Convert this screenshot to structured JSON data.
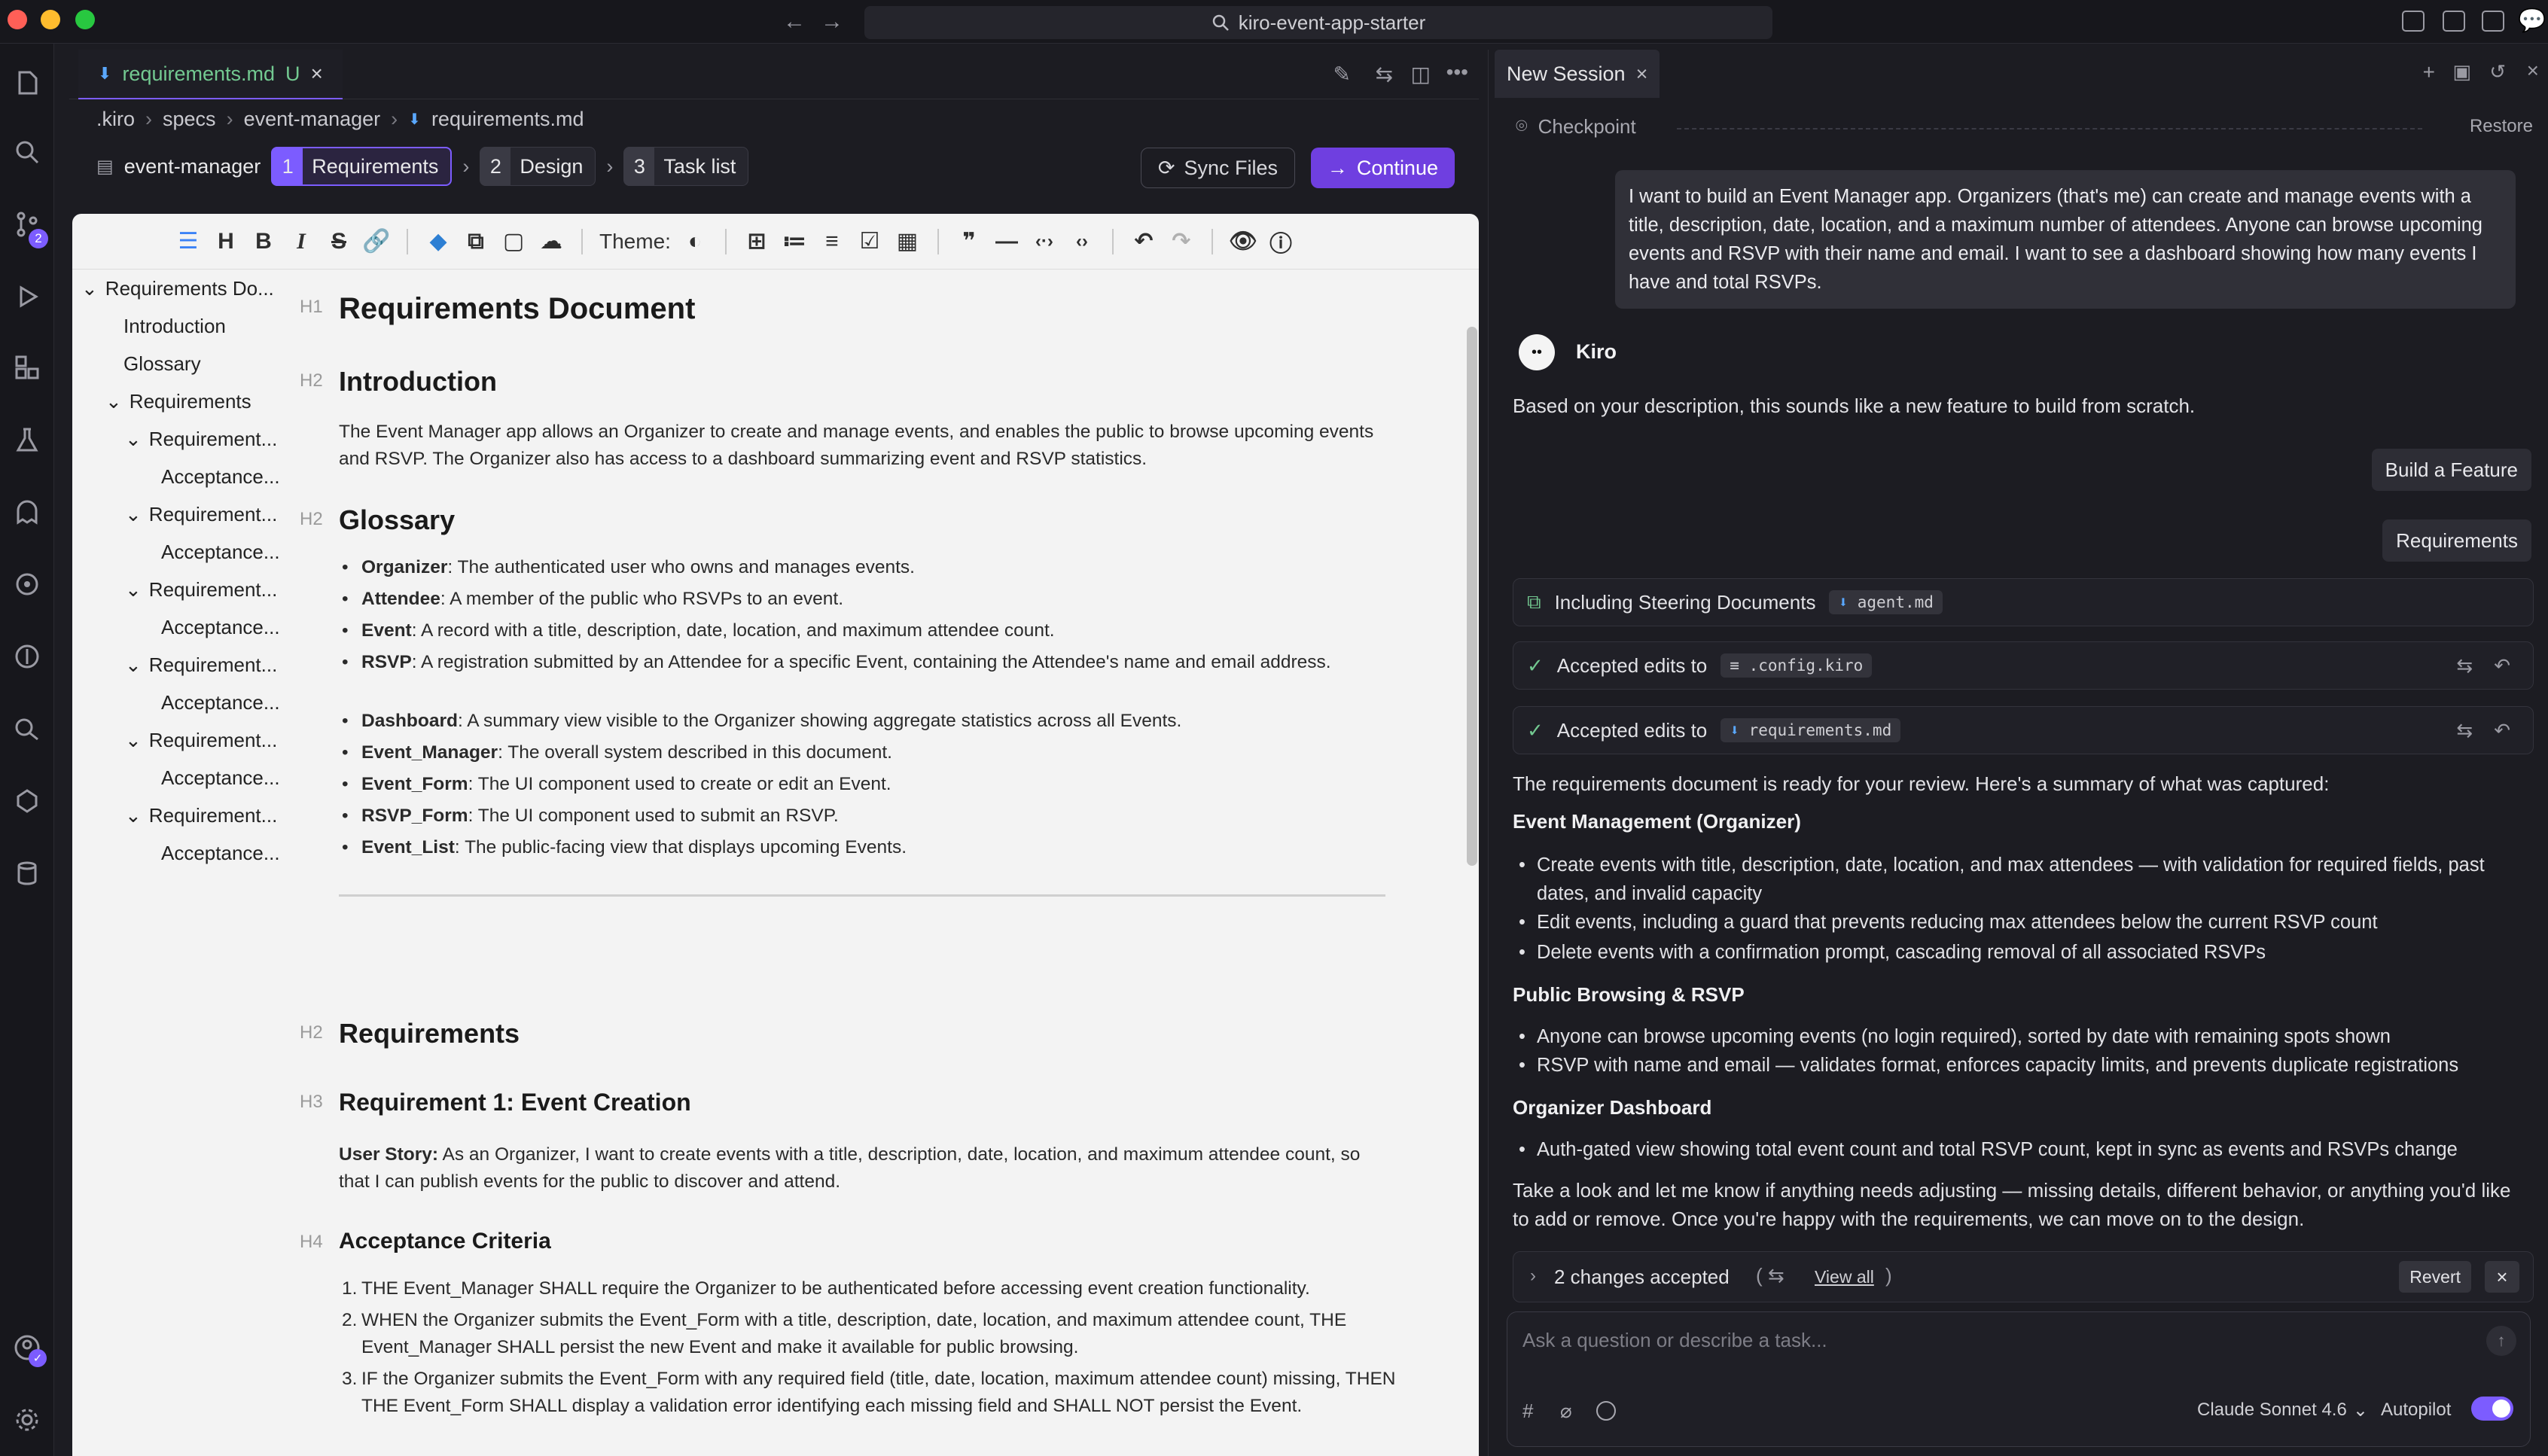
{
  "window": {
    "search_title": "kiro-event-app-starter"
  },
  "editor": {
    "tab": {
      "name": "requirements.md",
      "status": "U"
    },
    "breadcrumb": [
      ".kiro",
      "specs",
      "event-manager",
      "requirements.md"
    ],
    "spec": {
      "name": "event-manager",
      "steps": [
        {
          "num": "1",
          "label": "Requirements"
        },
        {
          "num": "2",
          "label": "Design"
        },
        {
          "num": "3",
          "label": "Task list"
        }
      ],
      "sync_label": "Sync Files",
      "continue_label": "Continue"
    },
    "toolbar": {
      "theme_label": "Theme:"
    },
    "outline": {
      "root": "Requirements Do...",
      "introduction": "Introduction",
      "glossary": "Glossary",
      "requirements": "Requirements",
      "requirement": "Requirement...",
      "acceptance": "Acceptance..."
    },
    "doc": {
      "h1": "Requirements Document",
      "intro_heading": "Introduction",
      "intro_text": "The Event Manager app allows an Organizer to create and manage events, and enables the public to browse upcoming events and RSVP. The Organizer also has access to a dashboard summarizing event and RSVP statistics.",
      "glossary_heading": "Glossary",
      "glossary": [
        {
          "term": "Organizer",
          "def": ": The authenticated user who owns and manages events."
        },
        {
          "term": "Attendee",
          "def": ": A member of the public who RSVPs to an event."
        },
        {
          "term": "Event",
          "def": ": A record with a title, description, date, location, and maximum attendee count."
        },
        {
          "term": "RSVP",
          "def": ": A registration submitted by an Attendee for a specific Event, containing the Attendee's name and email address."
        },
        {
          "term": "Dashboard",
          "def": ": A summary view visible to the Organizer showing aggregate statistics across all Events."
        },
        {
          "term": "Event_Manager",
          "def": ": The overall system described in this document."
        },
        {
          "term": "Event_Form",
          "def": ": The UI component used to create or edit an Event."
        },
        {
          "term": "RSVP_Form",
          "def": ": The UI component used to submit an RSVP."
        },
        {
          "term": "Event_List",
          "def": ": The public-facing view that displays upcoming Events."
        }
      ],
      "requirements_heading": "Requirements",
      "req1_heading": "Requirement 1: Event Creation",
      "user_story_label": "User Story:",
      "user_story": " As an Organizer, I want to create events with a title, description, date, location, and maximum attendee count, so that I can publish events for the public to discover and attend.",
      "ac_heading": "Acceptance Criteria",
      "criteria": [
        "THE Event_Manager SHALL require the Organizer to be authenticated before accessing event creation functionality.",
        "WHEN the Organizer submits the Event_Form with a title, description, date, location, and maximum attendee count, THE Event_Manager SHALL persist the new Event and make it available for public browsing.",
        "IF the Organizer submits the Event_Form with any required field (title, date, location, maximum attendee count) missing, THEN THE Event_Form SHALL display a validation error identifying each missing field and SHALL NOT persist the Event."
      ]
    }
  },
  "chat": {
    "tab_label": "New Session",
    "checkpoint_label": "Checkpoint",
    "restore_label": "Restore",
    "user_message": "I want to build an Event Manager app. Organizers (that's me) can create and manage events with a title, description, date, location, and a maximum number of attendees. Anyone can browse upcoming events and RSVP with their name and email. I want to see a dashboard showing how many events I have and total RSVPs.",
    "agent_name": "Kiro",
    "agent_intro": "Based on your description, this sounds like a new feature to build from scratch.",
    "pill_feature": "Build a Feature",
    "pill_requirements": "Requirements",
    "steering_label": "Including Steering Documents",
    "steering_file": "agent.md",
    "accepted_label": "Accepted edits to",
    "accepted_file_1": ".config.kiro",
    "accepted_file_2": "requirements.md",
    "summary_intro": "The requirements document is ready for your review. Here's a summary of what was captured:",
    "sections": [
      {
        "heading": "Event Management (Organizer)",
        "items": [
          "Create events with title, description, date, location, and max attendees — with validation for required fields, past dates, and invalid capacity",
          "Edit events, including a guard that prevents reducing max attendees below the current RSVP count",
          "Delete events with a confirmation prompt, cascading removal of all associated RSVPs"
        ]
      },
      {
        "heading": "Public Browsing & RSVP",
        "items": [
          "Anyone can browse upcoming events (no login required), sorted by date with remaining spots shown",
          "RSVP with name and email — validates format, enforces capacity limits, and prevents duplicate registrations"
        ]
      },
      {
        "heading": "Organizer Dashboard",
        "items": [
          "Auth-gated view showing total event count and total RSVP count, kept in sync as events and RSVPs change"
        ]
      }
    ],
    "closing": "Take a look and let me know if anything needs adjusting — missing details, different behavior, or anything you'd like to add or remove. Once you're happy with the requirements, we can move on to the design.",
    "changes_label": "2 changes accepted",
    "view_all_label": "View all",
    "revert_label": "Revert",
    "input_placeholder": "Ask a question or describe a task...",
    "model_label": "Claude Sonnet 4.6",
    "autopilot_label": "Autopilot",
    "autopilot_on": true
  },
  "activity_badges": {
    "source_control": "2"
  },
  "colors": {
    "accent": "#7c5cff",
    "continue": "#6f3fe0"
  }
}
